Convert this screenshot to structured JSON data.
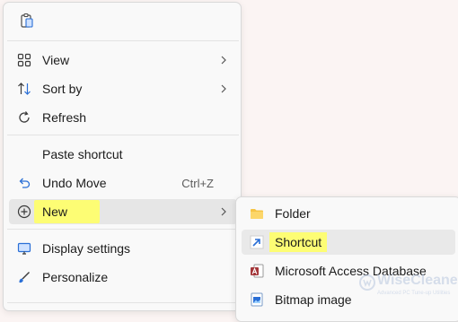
{
  "context_menu": {
    "items": [
      {
        "label": "View",
        "icon": "grid-icon"
      },
      {
        "label": "Sort by",
        "icon": "sort-icon"
      },
      {
        "label": "Refresh",
        "icon": "refresh-icon"
      },
      {
        "label": "Paste shortcut"
      },
      {
        "label": "Undo Move",
        "icon": "undo-icon",
        "accelerator": "Ctrl+Z"
      },
      {
        "label": "New",
        "icon": "plus-circle-icon"
      },
      {
        "label": "Display settings",
        "icon": "display-icon"
      },
      {
        "label": "Personalize",
        "icon": "brush-icon"
      }
    ]
  },
  "submenu_new": {
    "items": [
      {
        "label": "Folder",
        "icon": "folder-icon"
      },
      {
        "label": "Shortcut",
        "icon": "shortcut-icon"
      },
      {
        "label": "Microsoft Access Database",
        "icon": "access-database-icon"
      },
      {
        "label": "Bitmap image",
        "icon": "bitmap-icon"
      }
    ]
  },
  "watermark": {
    "title": "WiseCleaner",
    "subtitle": "Advanced PC Tune-up Utilities"
  },
  "colors": {
    "highlight": "#fdfd74",
    "accent": "#2a6fd6",
    "desktop": "#fbf4f3"
  }
}
